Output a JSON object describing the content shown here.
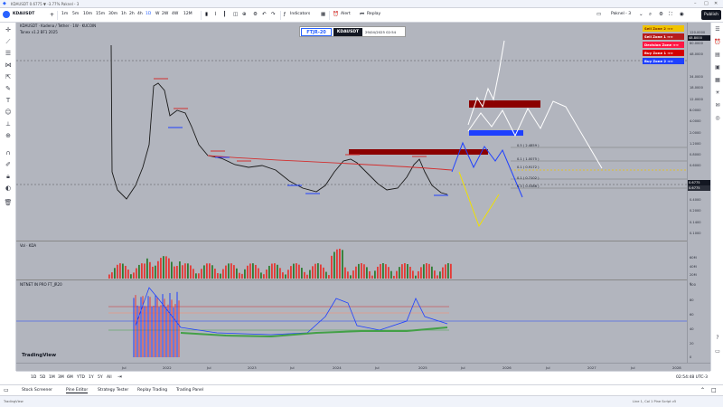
{
  "window": {
    "title": "KDAUSDT 0.6775 ▼ -3.77% Paknel - 3"
  },
  "toolbar": {
    "symbol": "KDAUSDT",
    "intervals": [
      "1m",
      "5m",
      "10m",
      "15m",
      "30m",
      "1h",
      "2h",
      "4h",
      "1D",
      "W",
      "2W",
      "4W",
      "12M"
    ],
    "active_interval": "1D",
    "indicators_label": "Indicators",
    "alert_label": "Alert",
    "replay_label": "Replay",
    "layout_label": "Paknel - 3",
    "publish_label": "Publish"
  },
  "legend": {
    "line1": "KDAUSDT · Kadena / Tether · 1W · KUCOIN",
    "line2": "Tonex v1.2 BF1 2025"
  },
  "badge": {
    "brand": "FTJR-20",
    "symbol": "KDAUSDT",
    "datetime": "29/04/2025 02:54"
  },
  "zones": [
    {
      "label": "Sell Zone 2 ⇒⇒",
      "bg": "#f0c400",
      "fg": "#7a1f00"
    },
    {
      "label": "Sell Zone 1 ⇒⇒",
      "bg": "#b71c1c",
      "fg": "#ffffff"
    },
    {
      "label": "Decision Zone ⇒⇒",
      "bg": "#ff1744",
      "fg": "#ffffff"
    },
    {
      "label": "Buy Zone 1 ⇒⇒",
      "bg": "#d50000",
      "fg": "#ffffff"
    },
    {
      "label": "Buy Zone 2 ⇒⇒",
      "bg": "#1e40ff",
      "fg": "#ffffff"
    }
  ],
  "fib_labels": [
    {
      "label": "0.5 ( 2.4859 )"
    },
    {
      "label": "0.1 ( 1.0075 )"
    },
    {
      "label": "0.1 ( 0.9172 )"
    },
    {
      "label": "0.1 ( 0.7102 )"
    },
    {
      "label": "0.3 ( 0.5386 )"
    }
  ],
  "price_axis": [
    "120.0000",
    "80.0000",
    "48.0000",
    "34.0000",
    "18.0000",
    "12.0000",
    "8.0000",
    "4.0000",
    "2.0000",
    "1.2000",
    "0.8000",
    "0.6000",
    "0.4000",
    "0.2000",
    "0.1400",
    "0.1000"
  ],
  "price_badges": [
    {
      "label": "48.8000",
      "bg": "#131722"
    },
    {
      "label": "0.6775",
      "bg": "#131722"
    },
    {
      "label": "0.6775",
      "bg": "#131722"
    }
  ],
  "vol_pane": {
    "label": "Vol · KDA",
    "axis": [
      "60M",
      "40M",
      "20M",
      "0"
    ]
  },
  "osc_pane": {
    "label": "NITNET IN PRO  FT_JR20",
    "axis": [
      "100",
      "80",
      "60",
      "40",
      "20",
      "0"
    ]
  },
  "time_axis": [
    "Jul",
    "2022",
    "Jul",
    "2023",
    "Jul",
    "2024",
    "Jul",
    "2025",
    "Jul",
    "2026",
    "Jul",
    "2027",
    "Jul",
    "2028"
  ],
  "range_bar": {
    "ranges": [
      "1D",
      "5D",
      "1M",
      "3M",
      "6M",
      "YTD",
      "1Y",
      "5Y",
      "All"
    ],
    "clock": "02:54:48 UTC-3"
  },
  "bottom_tabs": [
    "Stock Screener",
    "Pine Editor",
    "Strategy Tester",
    "Replay Trading",
    "Trading Panel"
  ],
  "active_bottom_tab": "Pine Editor",
  "status": {
    "left": "TradingView",
    "right": "Line 1, Col 1   Pine Script v5"
  },
  "tv_logo": "TradingView"
}
